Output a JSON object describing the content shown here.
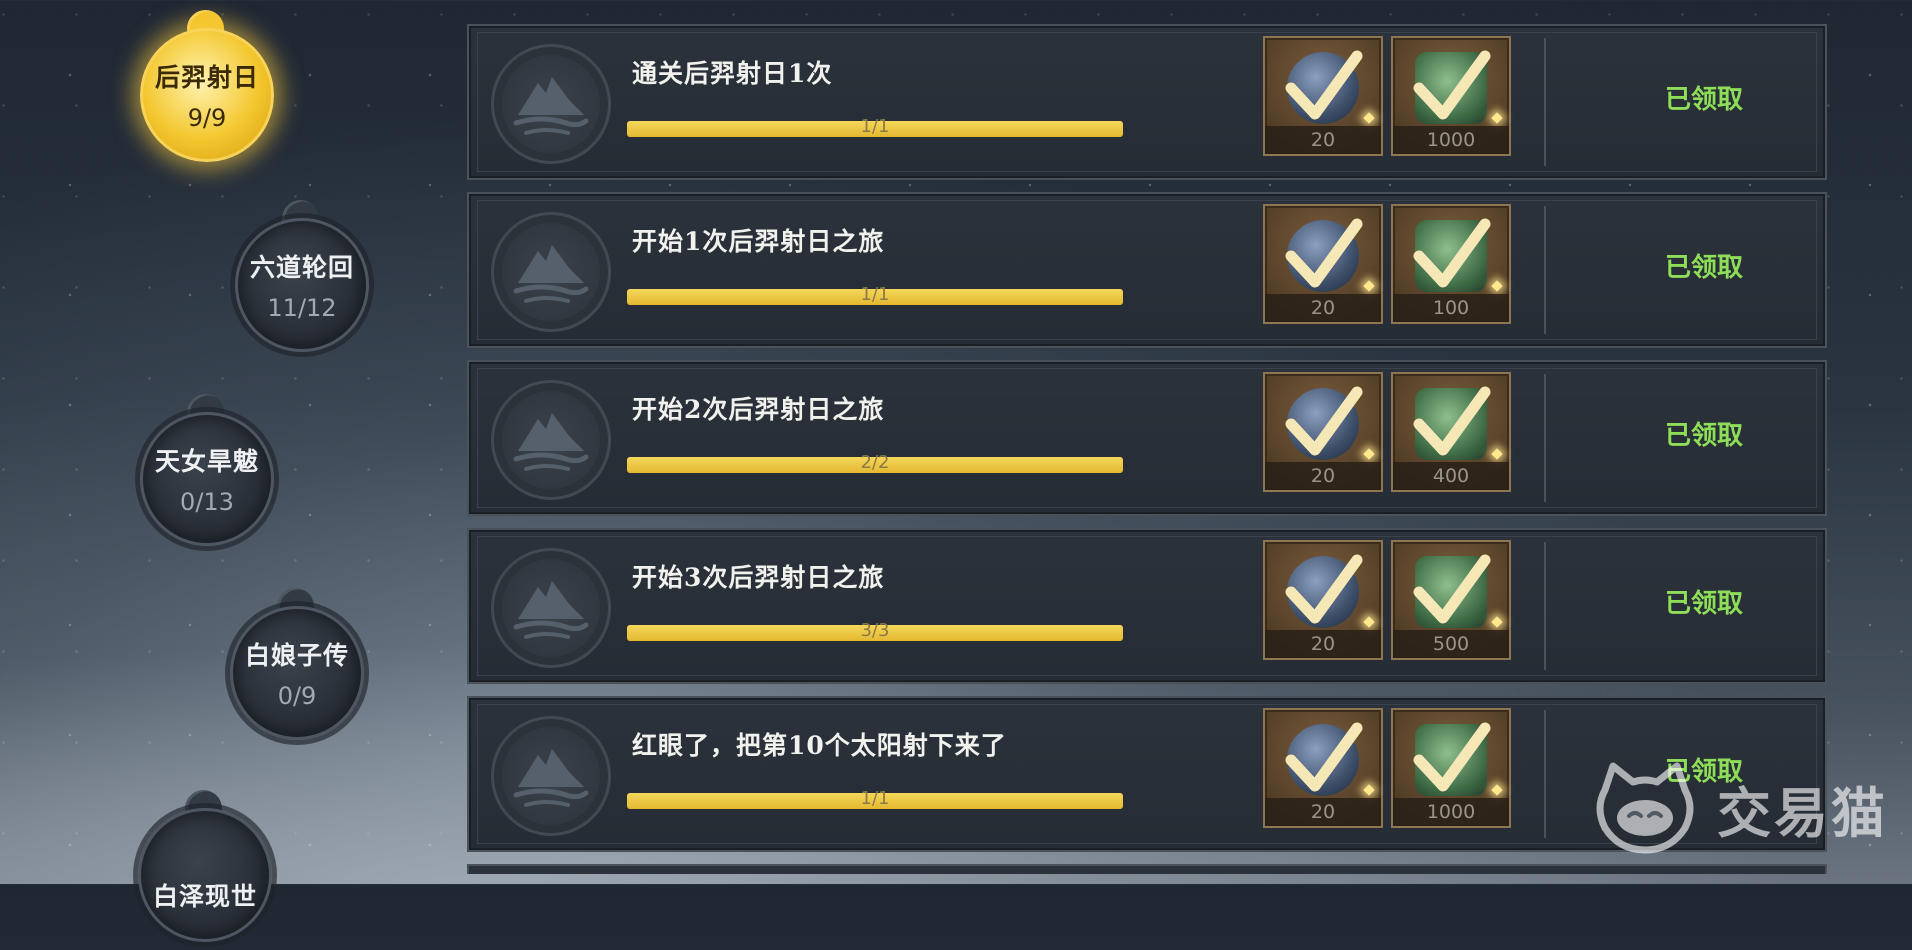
{
  "chapters": [
    {
      "name": "后羿射日",
      "count": "9/9",
      "active": true
    },
    {
      "name": "六道轮回",
      "count": "11/12",
      "active": false
    },
    {
      "name": "天女旱魃",
      "count": "0/13",
      "active": false
    },
    {
      "name": "白娘子传",
      "count": "0/9",
      "active": false
    },
    {
      "name": "白泽现世",
      "count": "",
      "active": false
    }
  ],
  "tasks": [
    {
      "title": "通关后羿射日1次",
      "progress_text": "1/1",
      "progress": 1.0,
      "rewards": [
        {
          "icon": "stone-icon",
          "amount": "20",
          "claimed": true
        },
        {
          "icon": "jade-icon",
          "amount": "1000",
          "claimed": true
        }
      ],
      "status": "已领取"
    },
    {
      "title": "开始1次后羿射日之旅",
      "progress_text": "1/1",
      "progress": 1.0,
      "rewards": [
        {
          "icon": "stone-icon",
          "amount": "20",
          "claimed": true
        },
        {
          "icon": "jade-icon",
          "amount": "100",
          "claimed": true
        }
      ],
      "status": "已领取"
    },
    {
      "title": "开始2次后羿射日之旅",
      "progress_text": "2/2",
      "progress": 1.0,
      "rewards": [
        {
          "icon": "stone-icon",
          "amount": "20",
          "claimed": true
        },
        {
          "icon": "jade-icon",
          "amount": "400",
          "claimed": true
        }
      ],
      "status": "已领取"
    },
    {
      "title": "开始3次后羿射日之旅",
      "progress_text": "3/3",
      "progress": 1.0,
      "rewards": [
        {
          "icon": "stone-icon",
          "amount": "20",
          "claimed": true
        },
        {
          "icon": "jade-icon",
          "amount": "500",
          "claimed": true
        }
      ],
      "status": "已领取"
    },
    {
      "title": "红眼了，把第10个太阳射下来了",
      "progress_text": "1/1",
      "progress": 1.0,
      "rewards": [
        {
          "icon": "stone-icon",
          "amount": "20",
          "claimed": true
        },
        {
          "icon": "jade-icon",
          "amount": "1000",
          "claimed": true
        }
      ],
      "status": "已领取"
    }
  ],
  "watermark": {
    "text": "交易猫",
    "icon": "cat-logo-icon"
  },
  "colors": {
    "status_green": "#8ede58",
    "progress_gold": "#e9c13c",
    "active_chapter": "#f3c72f"
  }
}
